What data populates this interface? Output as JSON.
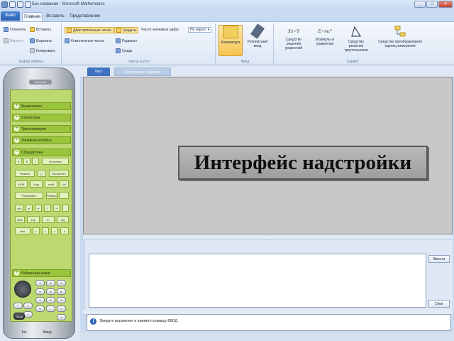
{
  "window": {
    "title": "Без названия - Microsoft Mathematics",
    "minimize": "_",
    "maximize": "□",
    "close": "✕"
  },
  "tabs": {
    "file": "Файл",
    "home": "Главная",
    "insert": "Вставить",
    "view": "Представление"
  },
  "ribbon": {
    "clipboard": {
      "cancel": "Отменить",
      "redo": "Вернуть",
      "paste": "Вставить",
      "cut": "Вырезать",
      "copy": "Копировать",
      "label": "Буфер обмена"
    },
    "numbers": {
      "real": "Действительные числа",
      "complex": "Комплексные числа",
      "degrees": "Градусы",
      "radians": "Радианы",
      "grads": "Грады",
      "sig_digits_label": "Число значимых цифр:",
      "sig_digits_value": "Не округл",
      "label": "Числа и угол"
    },
    "input": {
      "keyboard": "Клавиатура",
      "handwriting": "Рукописный ввод",
      "label": "Ввод"
    },
    "tools": {
      "equation_solver": "Средство решения уравнений",
      "formulas": "Формулы и уравнения",
      "triangle_solver": "Средство решения треугольников",
      "unit_converter": "Средство преобразования единиц измерения",
      "label": "Сервис"
    }
  },
  "calculator": {
    "brand": "Microsoft",
    "sections": {
      "calculus": "Вычисления",
      "statistics": "Статистика",
      "trigonometry": "Тригонометрия",
      "linear_algebra": "Линейная алгебра",
      "standard": "Стандартные",
      "favorites": "Избранные знаки"
    },
    "buttons": {
      "r1_pi": "π",
      "r1_e": "E",
      "r1_i": "i",
      "r1_clear": "Очистить",
      "r2_solve": "Решить",
      "r2_brackets": "( )",
      "r2_plot": "Построить",
      "r3_lcm": "НОК",
      "r3_gcd": "Нод",
      "r3_mod": "mod",
      "r3_abs": "|x|",
      "r4_factor": "Разложить",
      "r4_expand": "Раскрыть",
      "r5_1": "a/b",
      "r5_2": "x²",
      "r5_3": "xⁿ",
      "r5_4": "√",
      "r5_5": "ⁿ√",
      "r6_1": "Эксп",
      "r6_2": "exp",
      "r6_3": "ln",
      "r6_4": "log",
      "r7_1": "ans",
      "r7_2": "<",
      "r7_3": "=",
      "r7_4": ">",
      "r7_5": "≥"
    },
    "numkeys": [
      "7",
      "8",
      "9",
      "÷",
      "4",
      "5",
      "6",
      "×",
      "1",
      "2",
      "3",
      "−",
      "0",
      ",",
      "=",
      "+"
    ],
    "enter_key": "Ввод",
    "bottom_left": "Ins",
    "bottom_right": "Ввод"
  },
  "doc_tabs": {
    "worksheet": "Лист",
    "graphing": "Построение графиков"
  },
  "overlay_text": "Интерфейс надстройки",
  "input_panel": {
    "enter_button": "Ввести",
    "clear_button": "Clear",
    "splitter_dots": "· · ·"
  },
  "status": {
    "message": "Введите выражение и нажмите клавишу ВВОД."
  }
}
